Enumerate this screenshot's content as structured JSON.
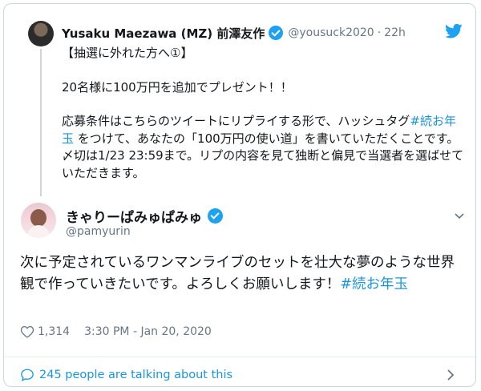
{
  "quoted": {
    "name": "Yusaku Maezawa (MZ) 前澤友作",
    "handle": "@yousuck2020",
    "separator": "·",
    "time": "22h",
    "lines": [
      "【抽選に外れた方へ①】",
      "20名様に100万円を追加でプレゼント！！"
    ],
    "para_prefix": "応募条件はこちらのツイートにリプライする形で、ハッシュタグ",
    "hashtag": "#続お年玉",
    "para_suffix": " をつけて、あなたの「100万円の使い道」を書いていただくことです。〆切は1/23 23:59まで。リプの内容を見て独断と偏見で当選者を選ばせていただきます。"
  },
  "tweet": {
    "name": "きゃりーぱみゅぱみゅ",
    "handle": "@pamyurin",
    "text": "次に予定されているワンマンライブのセットを壮大な夢のような世界観で作っていきたいです。よろしくお願いします！",
    "hashtag": "#続お年玉",
    "likes": "1,314",
    "timestamp": "3:30 PM - Jan 20, 2020"
  },
  "footer": {
    "talking": "245 people are talking about this"
  },
  "colors": {
    "accent": "#1da1f2",
    "link": "#1b95e0",
    "muted": "#657786"
  }
}
